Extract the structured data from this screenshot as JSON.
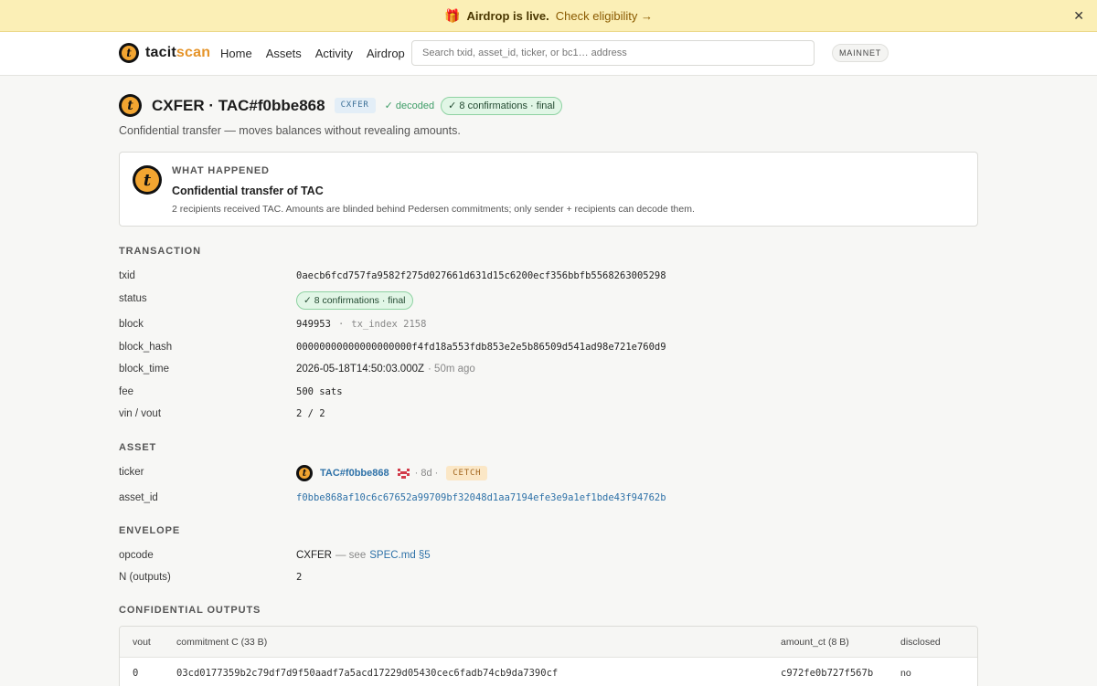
{
  "banner": {
    "icon": "gift-icon",
    "text": "Airdrop is live.",
    "link": "Check eligibility →",
    "close": "✕"
  },
  "nav": {
    "brand_prefix": "tacit",
    "brand_suffix": "scan",
    "links": [
      "Home",
      "Assets",
      "Activity",
      "Airdrop"
    ],
    "search_placeholder": "Search txid, asset_id, ticker, or bc1… address",
    "network": "MAINNET"
  },
  "header": {
    "title": "CXFER · TAC#f0bbe868",
    "ticker_chip": "CXFER",
    "decoded": "✓ decoded",
    "confirmations": "✓ 8 confirmations · final",
    "subtitle": "Confidential transfer — moves balances without revealing amounts."
  },
  "what_happened": {
    "kicker": "WHAT HAPPENED",
    "headline": "Confidential transfer of TAC",
    "description": "2 recipients received TAC. Amounts are blinded behind Pedersen commitments; only sender + recipients can decode them."
  },
  "transaction": {
    "section": "TRANSACTION",
    "txid_label": "txid",
    "txid": "0aecb6fcd757fa9582f275d027661d631d15c6200ecf356bbfb5568263005298",
    "status_label": "status",
    "status": "✓ 8 confirmations · final",
    "block_label": "block",
    "block": "949953",
    "block_sep": "·",
    "tx_index": "tx_index 2158",
    "block_hash_label": "block_hash",
    "block_hash": "00000000000000000000f4fd18a553fdb853e2e5b86509d541ad98e721e760d9",
    "block_time_label": "block_time",
    "block_time": "2026-05-18T14:50:03.000Z",
    "block_time_ago": "· 50m ago",
    "fee_label": "fee",
    "fee": "500 sats",
    "vinvout_label": "vin / vout",
    "vinvout": "2 / 2"
  },
  "asset": {
    "section": "ASSET",
    "ticker_label": "ticker",
    "ticker": "TAC#f0bbe868",
    "age": "· 8d ·",
    "badge": "CETCH",
    "asset_id_label": "asset_id",
    "asset_id": "f0bbe868af10c6c67652a99709bf32048d1aa7194efe3e9a1ef1bde43f94762b"
  },
  "envelope": {
    "section": "ENVELOPE",
    "opcode_label": "opcode",
    "opcode": "CXFER",
    "opcode_see": "— see",
    "opcode_link": "SPEC.md §5",
    "n_label": "N (outputs)",
    "n": "2"
  },
  "outputs": {
    "section": "CONFIDENTIAL OUTPUTS",
    "columns": [
      "vout",
      "commitment C (33 B)",
      "amount_ct (8 B)",
      "disclosed"
    ],
    "rows": [
      {
        "vout": "0",
        "commitment": "03cd0177359b2c79df7d9f50aadf7a5acd17229d05430cec6fadb74cb9da7390cf",
        "amount_ct": "c972fe0b727f567b",
        "disclosed": "no"
      }
    ]
  },
  "colors": {
    "accent": "#e5942a",
    "banner_bg": "#fbefb6",
    "success_bg": "#e1f6e6",
    "link": "#2f72a8"
  }
}
